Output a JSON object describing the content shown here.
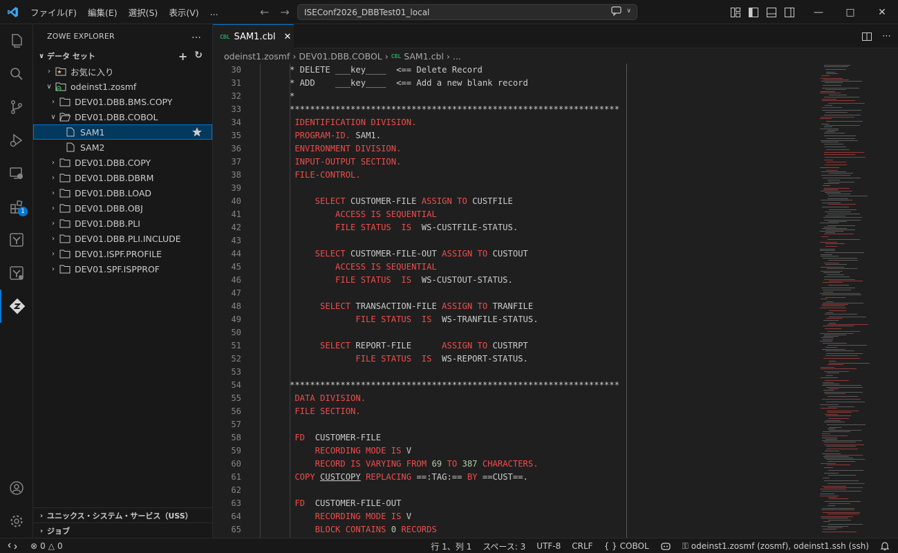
{
  "titlebar": {
    "menu": [
      "ファイル(F)",
      "編集(E)",
      "選択(S)",
      "表示(V)",
      "..."
    ],
    "search_text": "ISEConf2026_DBBTest01_local"
  },
  "activity_badge": "1",
  "sidebar": {
    "title": "ZOWE EXPLORER",
    "more": "...",
    "section": "データ セット",
    "favorites": "お気に入り",
    "profile": "odeinst1.zosmf",
    "datasets": [
      "DEV01.DBB.BMS.COPY",
      "DEV01.DBB.COBOL",
      "SAM1",
      "SAM2",
      "DEV01.DBB.COPY",
      "DEV01.DBB.DBRM",
      "DEV01.DBB.LOAD",
      "DEV01.DBB.OBJ",
      "DEV01.DBB.PLI",
      "DEV01.DBB.PLI.INCLUDE",
      "DEV01.ISPF.PROFILE",
      "DEV01.SPF.ISPPROF"
    ],
    "bottom_sections": [
      "ユニックス・システム・サービス（USS）",
      "ジョブ"
    ]
  },
  "editor": {
    "tab_label": "SAM1.cbl",
    "tab_lang": "CBL",
    "breadcrumb": [
      "odeinst1.zosmf",
      "DEV01.DBB.COBOL",
      "SAM1.cbl",
      "..."
    ],
    "lines": [
      {
        "n": "30",
        "segs": [
          [
            "* DELETE ___key____  <== Delete Record",
            ""
          ]
        ]
      },
      {
        "n": "31",
        "segs": [
          [
            "* ADD    ___key____  <== Add a new blank record",
            ""
          ]
        ]
      },
      {
        "n": "32",
        "segs": [
          [
            "*",
            ""
          ]
        ]
      },
      {
        "n": "33",
        "segs": [
          [
            "*****************************************************************",
            ""
          ]
        ]
      },
      {
        "n": "34",
        "segs": [
          [
            " IDENTIFICATION DIVISION.",
            "kw"
          ]
        ]
      },
      {
        "n": "35",
        "segs": [
          [
            " PROGRAM-ID.",
            "kw"
          ],
          [
            " SAM1.",
            ""
          ]
        ]
      },
      {
        "n": "36",
        "segs": [
          [
            " ENVIRONMENT DIVISION.",
            "kw"
          ]
        ]
      },
      {
        "n": "37",
        "segs": [
          [
            " INPUT-OUTPUT SECTION.",
            "kw"
          ]
        ]
      },
      {
        "n": "38",
        "segs": [
          [
            " FILE-CONTROL.",
            "kw"
          ]
        ]
      },
      {
        "n": "39",
        "segs": [
          [
            "",
            ""
          ]
        ]
      },
      {
        "n": "40",
        "segs": [
          [
            "     SELECT",
            "kw"
          ],
          [
            " CUSTOMER-FILE ",
            ""
          ],
          [
            "ASSIGN TO",
            "kw"
          ],
          [
            " CUSTFILE",
            ""
          ]
        ]
      },
      {
        "n": "41",
        "segs": [
          [
            "         ACCESS IS SEQUENTIAL",
            "kw"
          ]
        ]
      },
      {
        "n": "42",
        "segs": [
          [
            "         FILE STATUS  IS",
            "kw"
          ],
          [
            "  WS-CUSTFILE-STATUS.",
            ""
          ]
        ]
      },
      {
        "n": "43",
        "segs": [
          [
            "",
            ""
          ]
        ]
      },
      {
        "n": "44",
        "segs": [
          [
            "     SELECT",
            "kw"
          ],
          [
            " CUSTOMER-FILE-OUT ",
            ""
          ],
          [
            "ASSIGN TO",
            "kw"
          ],
          [
            " CUSTOUT",
            ""
          ]
        ]
      },
      {
        "n": "45",
        "segs": [
          [
            "         ACCESS IS SEQUENTIAL",
            "kw"
          ]
        ]
      },
      {
        "n": "46",
        "segs": [
          [
            "         FILE STATUS  IS",
            "kw"
          ],
          [
            "  WS-CUSTOUT-STATUS.",
            ""
          ]
        ]
      },
      {
        "n": "47",
        "segs": [
          [
            "",
            ""
          ]
        ]
      },
      {
        "n": "48",
        "segs": [
          [
            "      SELECT",
            "kw"
          ],
          [
            " TRANSACTION-FILE ",
            ""
          ],
          [
            "ASSIGN TO",
            "kw"
          ],
          [
            " TRANFILE",
            ""
          ]
        ]
      },
      {
        "n": "49",
        "segs": [
          [
            "             FILE STATUS  IS",
            "kw"
          ],
          [
            "  WS-TRANFILE-STATUS.",
            ""
          ]
        ]
      },
      {
        "n": "50",
        "segs": [
          [
            "",
            ""
          ]
        ]
      },
      {
        "n": "51",
        "segs": [
          [
            "      SELECT",
            "kw"
          ],
          [
            " REPORT-FILE      ",
            ""
          ],
          [
            "ASSIGN TO",
            "kw"
          ],
          [
            " CUSTRPT",
            ""
          ]
        ]
      },
      {
        "n": "52",
        "segs": [
          [
            "             FILE STATUS  IS",
            "kw"
          ],
          [
            "  WS-REPORT-STATUS.",
            ""
          ]
        ]
      },
      {
        "n": "53",
        "segs": [
          [
            "",
            ""
          ]
        ]
      },
      {
        "n": "54",
        "segs": [
          [
            "*****************************************************************",
            ""
          ]
        ]
      },
      {
        "n": "55",
        "segs": [
          [
            " DATA DIVISION.",
            "kw"
          ]
        ]
      },
      {
        "n": "56",
        "segs": [
          [
            " FILE SECTION.",
            "kw"
          ]
        ]
      },
      {
        "n": "57",
        "segs": [
          [
            "",
            ""
          ]
        ]
      },
      {
        "n": "58",
        "segs": [
          [
            " FD",
            "kw"
          ],
          [
            "  CUSTOMER-FILE",
            ""
          ]
        ]
      },
      {
        "n": "59",
        "segs": [
          [
            "     RECORDING MODE IS",
            "kw"
          ],
          [
            " V",
            ""
          ]
        ]
      },
      {
        "n": "60",
        "segs": [
          [
            "     RECORD IS VARYING FROM",
            "kw"
          ],
          [
            " 69",
            "num"
          ],
          [
            " TO",
            "kw"
          ],
          [
            " 387",
            "num"
          ],
          [
            " CHARACTERS.",
            "kw"
          ]
        ]
      },
      {
        "n": "61",
        "segs": [
          [
            " COPY",
            "kw"
          ],
          [
            " ",
            ""
          ],
          [
            "CUSTCOPY",
            "ul"
          ],
          [
            " REPLACING",
            "kw"
          ],
          [
            " ==:TAG:== ",
            ""
          ],
          [
            "BY",
            "kw"
          ],
          [
            " ==CUST==.",
            ""
          ]
        ]
      },
      {
        "n": "62",
        "segs": [
          [
            "",
            ""
          ]
        ]
      },
      {
        "n": "63",
        "segs": [
          [
            " FD",
            "kw"
          ],
          [
            "  CUSTOMER-FILE-OUT",
            ""
          ]
        ]
      },
      {
        "n": "64",
        "segs": [
          [
            "     RECORDING MODE IS",
            "kw"
          ],
          [
            " V",
            ""
          ]
        ]
      },
      {
        "n": "65",
        "segs": [
          [
            "     BLOCK CONTAINS",
            "kw"
          ],
          [
            " 0",
            "num"
          ],
          [
            " RECORDS",
            "kw"
          ]
        ]
      }
    ]
  },
  "statusbar": {
    "errors": "0",
    "warnings": "0",
    "position": "行 1、列 1",
    "spaces": "スペース: 3",
    "encoding": "UTF-8",
    "eol": "CRLF",
    "language": "COBOL",
    "language_braces": "{ }",
    "connection": "odeinst1.zosmf (zosmf), odeinst1.ssh (ssh)"
  },
  "colors": {
    "accent": "#0078d4",
    "keyword": "#f14c4c",
    "number": "#b5cea8",
    "cbl_badge": "#29a35a"
  }
}
